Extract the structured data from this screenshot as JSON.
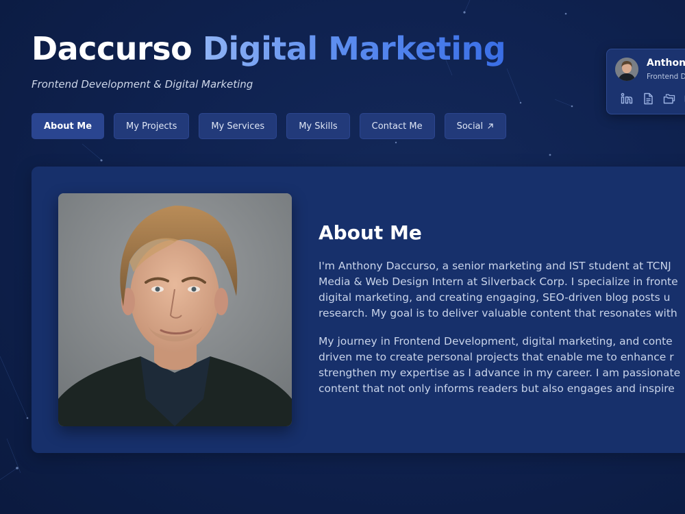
{
  "header": {
    "title_part1": "Daccurso",
    "title_part2": "Digital Marketing",
    "tagline": "Frontend Development & Digital Marketing"
  },
  "nav": {
    "items": [
      {
        "label": "About Me",
        "active": true
      },
      {
        "label": "My Projects"
      },
      {
        "label": "My Services"
      },
      {
        "label": "My Skills"
      },
      {
        "label": "Contact Me"
      },
      {
        "label": "Social",
        "icon": "external-arrow-icon"
      }
    ]
  },
  "profile_card": {
    "name": "Anthon",
    "role": "Frontend D",
    "icons": [
      "linkedin-icon",
      "document-icon",
      "folders-icon",
      "more-icon"
    ]
  },
  "about": {
    "heading": "About Me",
    "paragraph1_lines": [
      "I'm Anthony Daccurso, a senior marketing and IST student at TCNJ",
      "Media & Web Design Intern at Silverback Corp. I specialize in fronte",
      "digital marketing, and creating engaging, SEO-driven blog posts u",
      "research. My goal is to deliver valuable content that resonates with"
    ],
    "paragraph2_lines": [
      "My journey in Frontend Development, digital marketing, and conte",
      "driven me to create personal projects that enable me to enhance r",
      "strengthen my expertise as I advance in my career. I am passionate",
      "content that not only informs readers but also engages and inspire"
    ]
  },
  "colors": {
    "background": "#0f2250",
    "panel": "#17306b",
    "nav_button": "#223a7a",
    "accent_gradient_start": "#8fb3f5",
    "accent_gradient_end": "#3a6ee6"
  }
}
